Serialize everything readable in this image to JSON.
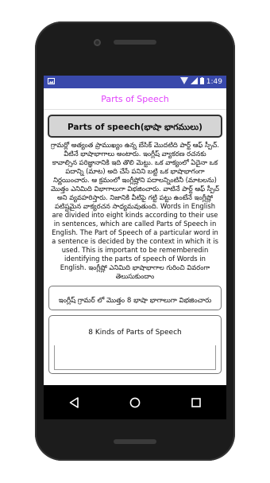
{
  "status": {
    "time": "1:49",
    "icons": [
      "image-icon",
      "wifi-icon",
      "signal-icon",
      "battery-icon"
    ]
  },
  "appbar": {
    "title": "Parts of Speech"
  },
  "content": {
    "heading": "Parts of speech(భాషా భాగములు)",
    "body": "గ్రామర్లో అత్యంత ప్రాముఖ్యం ఉన్న బేసిక్ మొదటిది పార్ట్ ఆఫ్ స్పీచ్. వీటినే భాషాభాగాలు అంటారు. ఇంగ్లీష్ వ్యాకరణ రచనకు కావాల్సిన పరిజ్ఞానానికి ఇది తొలి మెట్టు. ఒక వాక్యంలో ఏదైనా ఒక పదాన్ని (మాట) అది చేసే పనిని బట్టి ఒక భాషాభాగంగా నిర్ణయించారు. ఆ క్రమంలో ఇంగ్లీష్లోని పదాలన్నింటినీ (మాటలను) మొత్తం ఎనిమిది విభాగాలుగా విభజించారు. వాటినే పార్ట్ ఆఫ్ స్పీచ్ అని వ్యవహరిస్తారు. నిజానికి వీటిపై గట్టి పట్టు ఉంటేనే ఇంగ్లీష్లో పటిష్టమైన వాక్యరచన సాధ్యమవుతుంది. Words in English are divided into eight kinds according to their use in sentences, which are called Parts of Speech in English. The Part of Speech of a particular word in a sentence is decided by the context in which it is used. This is important to be rememberedin identifying the parts of speech of Words in English. ఇంగ్లీష్లో ఎనిమిది భాషాభాగాల గురించి వివరంగా తెలుసుకుందాం",
    "card1": "ఇంగ్లీష్ గ్రామర్ లో మొత్తం 8 భాషా భాగాలుగా విభజించారు",
    "card2": "8 Kinds of Parts of Speech"
  },
  "nav": {
    "items": [
      "back-icon",
      "home-icon",
      "recents-icon"
    ]
  },
  "colors": {
    "status": "#3949ab",
    "title": "#e040fb",
    "heading_bg": "#d5d5d5"
  }
}
